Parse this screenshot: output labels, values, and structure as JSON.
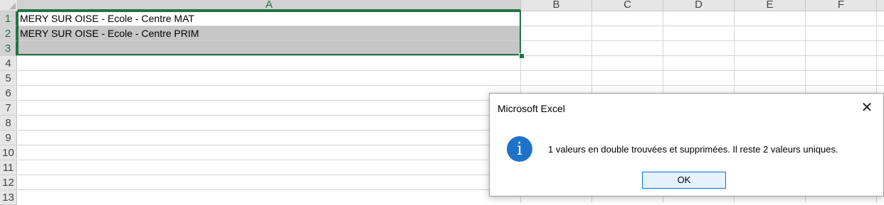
{
  "columns": [
    "A",
    "B",
    "C",
    "D",
    "E",
    "F"
  ],
  "rows": [
    "1",
    "2",
    "3",
    "4",
    "5",
    "6",
    "7",
    "8",
    "9",
    "10",
    "11",
    "12",
    "13"
  ],
  "cells": {
    "a1": "MERY SUR OISE - Ecole - Centre MAT",
    "a2": "MERY SUR OISE - Ecole - Centre PRIM",
    "a3": ""
  },
  "colors": {
    "accent": "#217346",
    "selection_fill": "#c6c6c6",
    "info_icon": "#1f72c9",
    "ok_button_border": "#0078d7"
  },
  "dialog": {
    "title": "Microsoft Excel",
    "close_glyph": "✕",
    "icon_glyph": "i",
    "message": "1 valeurs en double trouvées et supprimées. Il reste 2 valeurs uniques.",
    "ok_label": "OK"
  }
}
